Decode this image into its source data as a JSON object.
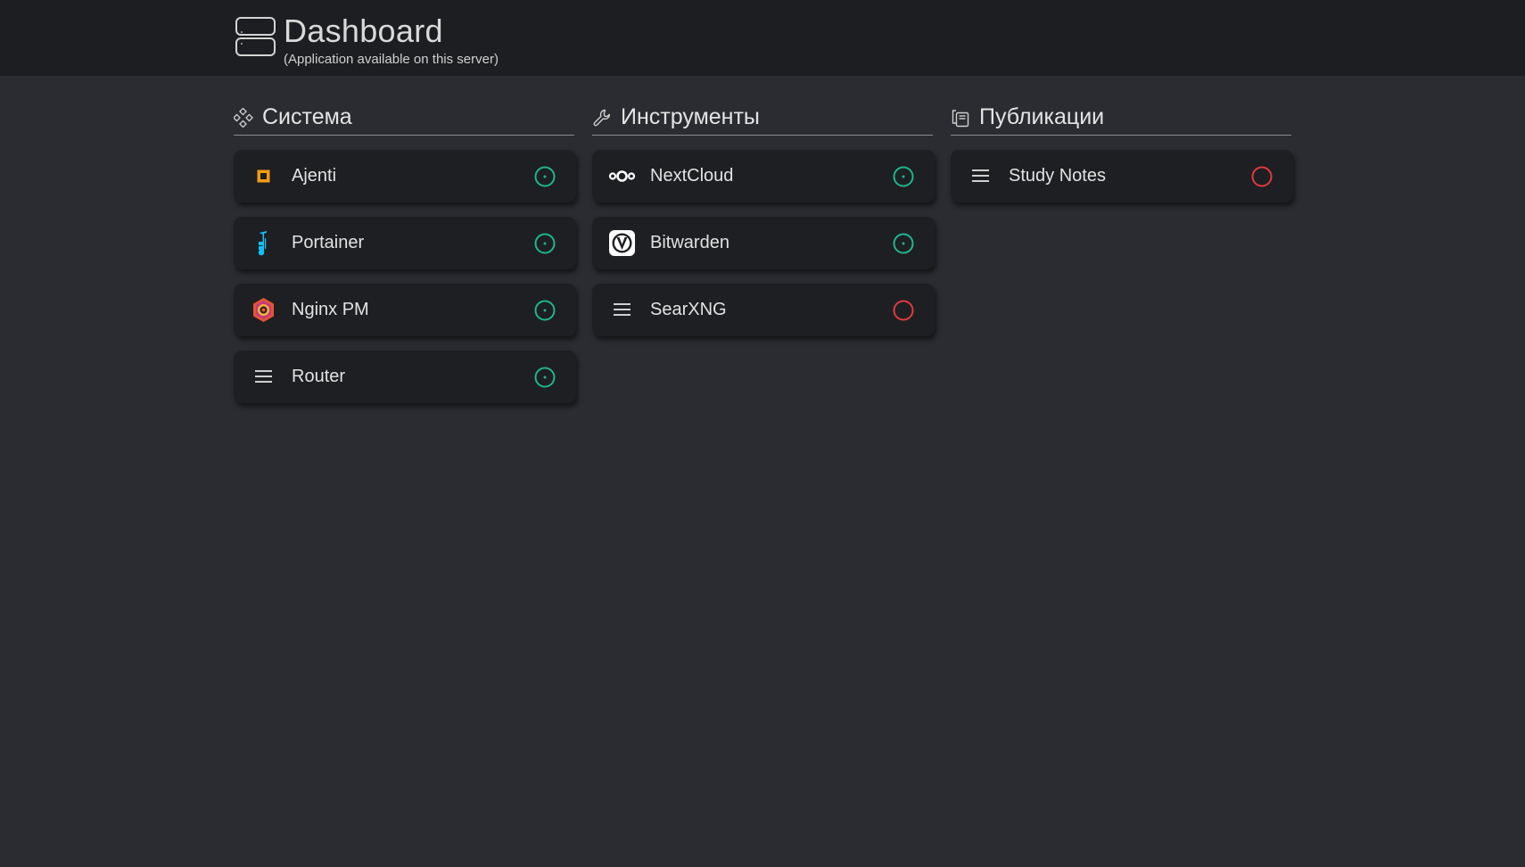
{
  "header": {
    "title": "Dashboard",
    "subtitle": "(Application available on this server)",
    "icon": "server-icon"
  },
  "colors": {
    "background": "#2b2c31",
    "topbar": "#1d1e21",
    "card": "#1e1f22",
    "status_online": "#1fb58f",
    "status_offline": "#e0393e"
  },
  "columns": [
    {
      "title": "Система",
      "icon": "system-diamonds-icon",
      "items": [
        {
          "label": "Ajenti",
          "icon": "ajenti-icon",
          "status": "online"
        },
        {
          "label": "Portainer",
          "icon": "portainer-icon",
          "status": "online"
        },
        {
          "label": "Nginx PM",
          "icon": "nginx-pm-icon",
          "status": "online"
        },
        {
          "label": "Router",
          "icon": "menu-lines-icon",
          "status": "online"
        }
      ]
    },
    {
      "title": "Инструменты",
      "icon": "wrench-icon",
      "items": [
        {
          "label": "NextCloud",
          "icon": "nextcloud-icon",
          "status": "online"
        },
        {
          "label": "Bitwarden",
          "icon": "bitwarden-icon",
          "status": "online"
        },
        {
          "label": "SearXNG",
          "icon": "menu-lines-icon",
          "status": "offline"
        }
      ]
    },
    {
      "title": "Публикации",
      "icon": "copy-pages-icon",
      "items": [
        {
          "label": "Study Notes",
          "icon": "menu-lines-icon",
          "status": "offline"
        }
      ]
    }
  ]
}
